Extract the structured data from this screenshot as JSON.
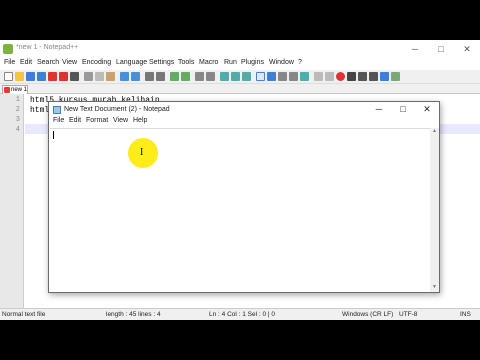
{
  "npp": {
    "title": "*new 1 - Notepad++",
    "win_min": "─",
    "win_max": "□",
    "win_close": "✕",
    "menu": [
      "File",
      "Edit",
      "Search",
      "View",
      "Encoding",
      "Language",
      "Settings",
      "Tools",
      "Macro",
      "Run",
      "Plugins",
      "Window",
      "?"
    ],
    "tab_label": "new 1",
    "line_numbers": [
      "1",
      "2",
      "3",
      "4"
    ],
    "lines": [
      "html5 kursus murah kelihain",
      "html"
    ],
    "status": {
      "type": "Normal text file",
      "length": "length : 45   lines : 4",
      "pos": "Ln : 4   Col : 1   Sel : 0 | 0",
      "eol": "Windows (CR LF)",
      "enc": "UTF-8",
      "mode": "INS"
    }
  },
  "notepad": {
    "title": "New Text Document (2) - Notepad",
    "menu": [
      "File",
      "Edit",
      "Format",
      "View",
      "Help"
    ],
    "btn_min": "─",
    "btn_max": "□",
    "btn_close": "✕",
    "text": ""
  },
  "colors": {
    "highlight": "#ffea00",
    "current_line": "#e8e8ff"
  },
  "icons": {
    "cursor": "text-cursor-icon"
  }
}
